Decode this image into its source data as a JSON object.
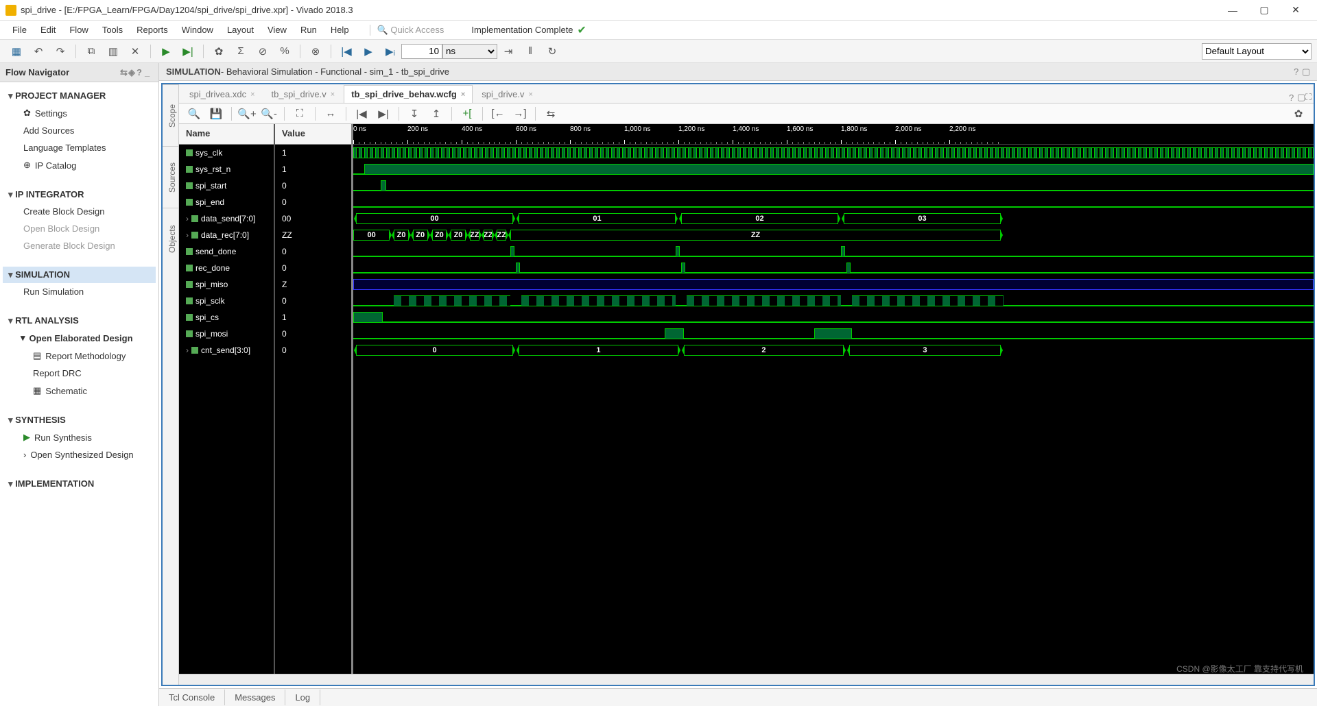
{
  "title": "spi_drive - [E:/FPGA_Learn/FPGA/Day1204/spi_drive/spi_drive.xpr] - Vivado 2018.3",
  "menubar": [
    "File",
    "Edit",
    "Flow",
    "Tools",
    "Reports",
    "Window",
    "Layout",
    "View",
    "Run",
    "Help"
  ],
  "quick_access_placeholder": "Quick Access",
  "status": "Implementation Complete",
  "toolbar_time_value": "10",
  "toolbar_time_unit": "ns",
  "layout_dropdown": "Default Layout",
  "flow_nav_title": "Flow Navigator",
  "nav": {
    "pm": {
      "title": "PROJECT MANAGER",
      "items": [
        "Settings",
        "Add Sources",
        "Language Templates",
        "IP Catalog"
      ]
    },
    "ipi": {
      "title": "IP INTEGRATOR",
      "items": [
        "Create Block Design",
        "Open Block Design",
        "Generate Block Design"
      ]
    },
    "sim": {
      "title": "SIMULATION",
      "items": [
        "Run Simulation"
      ]
    },
    "rtl": {
      "title": "RTL ANALYSIS",
      "sub": "Open Elaborated Design",
      "items": [
        "Report Methodology",
        "Report DRC",
        "Schematic"
      ]
    },
    "syn": {
      "title": "SYNTHESIS",
      "items": [
        "Run Synthesis",
        "Open Synthesized Design"
      ]
    },
    "impl": {
      "title": "IMPLEMENTATION"
    }
  },
  "sim_header": {
    "bold": "SIMULATION",
    "rest": " - Behavioral Simulation - Functional - sim_1 - tb_spi_drive"
  },
  "sidetabs": [
    "Scope",
    "Sources",
    "Objects"
  ],
  "filetabs": [
    {
      "label": "spi_drivea.xdc",
      "active": false
    },
    {
      "label": "tb_spi_drive.v",
      "active": false
    },
    {
      "label": "tb_spi_drive_behav.wcfg",
      "active": true
    },
    {
      "label": "spi_drive.v",
      "active": false
    }
  ],
  "wave_headers": {
    "name": "Name",
    "value": "Value"
  },
  "signals": [
    {
      "name": "sys_clk",
      "value": "1"
    },
    {
      "name": "sys_rst_n",
      "value": "1"
    },
    {
      "name": "spi_start",
      "value": "0"
    },
    {
      "name": "spi_end",
      "value": "0"
    },
    {
      "name": "data_send[7:0]",
      "value": "00",
      "bus": true
    },
    {
      "name": "data_rec[7:0]",
      "value": "ZZ",
      "bus": true
    },
    {
      "name": "send_done",
      "value": "0"
    },
    {
      "name": "rec_done",
      "value": "0"
    },
    {
      "name": "spi_miso",
      "value": "Z"
    },
    {
      "name": "spi_sclk",
      "value": "0"
    },
    {
      "name": "spi_cs",
      "value": "1"
    },
    {
      "name": "spi_mosi",
      "value": "0"
    },
    {
      "name": "cnt_send[3:0]",
      "value": "0",
      "bus": true
    }
  ],
  "ruler_labels": [
    "0 ns",
    "200 ns",
    "400 ns",
    "600 ns",
    "800 ns",
    "1,000 ns",
    "1,200 ns",
    "1,400 ns",
    "1,600 ns",
    "1,800 ns",
    "2,000 ns",
    "2,200 ns"
  ],
  "data_send_segments": [
    "00",
    "01",
    "02",
    "03"
  ],
  "data_rec_segments": [
    "00",
    "Z0",
    "Z0",
    "Z0",
    "Z0",
    "ZZ",
    "ZZ",
    "ZZ",
    "ZZ"
  ],
  "cnt_send_segments": [
    "0",
    "1",
    "2",
    "3"
  ],
  "bottom_tabs": [
    "Tcl Console",
    "Messages",
    "Log"
  ],
  "watermark": "CSDN @影像太工厂 靠支持代写机"
}
